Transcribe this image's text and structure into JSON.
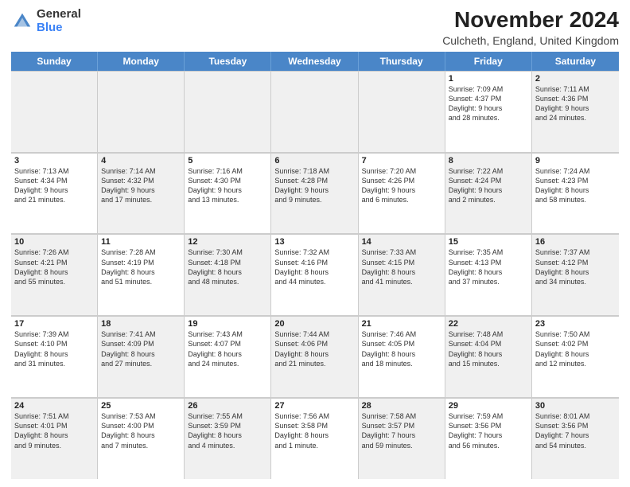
{
  "logo": {
    "general": "General",
    "blue": "Blue"
  },
  "title": {
    "month": "November 2024",
    "location": "Culcheth, England, United Kingdom"
  },
  "header_days": [
    "Sunday",
    "Monday",
    "Tuesday",
    "Wednesday",
    "Thursday",
    "Friday",
    "Saturday"
  ],
  "weeks": [
    [
      {
        "day": "",
        "info": "",
        "shaded": true
      },
      {
        "day": "",
        "info": "",
        "shaded": true
      },
      {
        "day": "",
        "info": "",
        "shaded": true
      },
      {
        "day": "",
        "info": "",
        "shaded": true
      },
      {
        "day": "",
        "info": "",
        "shaded": true
      },
      {
        "day": "1",
        "info": "Sunrise: 7:09 AM\nSunset: 4:37 PM\nDaylight: 9 hours\nand 28 minutes."
      },
      {
        "day": "2",
        "info": "Sunrise: 7:11 AM\nSunset: 4:36 PM\nDaylight: 9 hours\nand 24 minutes.",
        "shaded": true
      }
    ],
    [
      {
        "day": "3",
        "info": "Sunrise: 7:13 AM\nSunset: 4:34 PM\nDaylight: 9 hours\nand 21 minutes."
      },
      {
        "day": "4",
        "info": "Sunrise: 7:14 AM\nSunset: 4:32 PM\nDaylight: 9 hours\nand 17 minutes.",
        "shaded": true
      },
      {
        "day": "5",
        "info": "Sunrise: 7:16 AM\nSunset: 4:30 PM\nDaylight: 9 hours\nand 13 minutes."
      },
      {
        "day": "6",
        "info": "Sunrise: 7:18 AM\nSunset: 4:28 PM\nDaylight: 9 hours\nand 9 minutes.",
        "shaded": true
      },
      {
        "day": "7",
        "info": "Sunrise: 7:20 AM\nSunset: 4:26 PM\nDaylight: 9 hours\nand 6 minutes."
      },
      {
        "day": "8",
        "info": "Sunrise: 7:22 AM\nSunset: 4:24 PM\nDaylight: 9 hours\nand 2 minutes.",
        "shaded": true
      },
      {
        "day": "9",
        "info": "Sunrise: 7:24 AM\nSunset: 4:23 PM\nDaylight: 8 hours\nand 58 minutes."
      }
    ],
    [
      {
        "day": "10",
        "info": "Sunrise: 7:26 AM\nSunset: 4:21 PM\nDaylight: 8 hours\nand 55 minutes.",
        "shaded": true
      },
      {
        "day": "11",
        "info": "Sunrise: 7:28 AM\nSunset: 4:19 PM\nDaylight: 8 hours\nand 51 minutes."
      },
      {
        "day": "12",
        "info": "Sunrise: 7:30 AM\nSunset: 4:18 PM\nDaylight: 8 hours\nand 48 minutes.",
        "shaded": true
      },
      {
        "day": "13",
        "info": "Sunrise: 7:32 AM\nSunset: 4:16 PM\nDaylight: 8 hours\nand 44 minutes."
      },
      {
        "day": "14",
        "info": "Sunrise: 7:33 AM\nSunset: 4:15 PM\nDaylight: 8 hours\nand 41 minutes.",
        "shaded": true
      },
      {
        "day": "15",
        "info": "Sunrise: 7:35 AM\nSunset: 4:13 PM\nDaylight: 8 hours\nand 37 minutes."
      },
      {
        "day": "16",
        "info": "Sunrise: 7:37 AM\nSunset: 4:12 PM\nDaylight: 8 hours\nand 34 minutes.",
        "shaded": true
      }
    ],
    [
      {
        "day": "17",
        "info": "Sunrise: 7:39 AM\nSunset: 4:10 PM\nDaylight: 8 hours\nand 31 minutes."
      },
      {
        "day": "18",
        "info": "Sunrise: 7:41 AM\nSunset: 4:09 PM\nDaylight: 8 hours\nand 27 minutes.",
        "shaded": true
      },
      {
        "day": "19",
        "info": "Sunrise: 7:43 AM\nSunset: 4:07 PM\nDaylight: 8 hours\nand 24 minutes."
      },
      {
        "day": "20",
        "info": "Sunrise: 7:44 AM\nSunset: 4:06 PM\nDaylight: 8 hours\nand 21 minutes.",
        "shaded": true
      },
      {
        "day": "21",
        "info": "Sunrise: 7:46 AM\nSunset: 4:05 PM\nDaylight: 8 hours\nand 18 minutes."
      },
      {
        "day": "22",
        "info": "Sunrise: 7:48 AM\nSunset: 4:04 PM\nDaylight: 8 hours\nand 15 minutes.",
        "shaded": true
      },
      {
        "day": "23",
        "info": "Sunrise: 7:50 AM\nSunset: 4:02 PM\nDaylight: 8 hours\nand 12 minutes."
      }
    ],
    [
      {
        "day": "24",
        "info": "Sunrise: 7:51 AM\nSunset: 4:01 PM\nDaylight: 8 hours\nand 9 minutes.",
        "shaded": true
      },
      {
        "day": "25",
        "info": "Sunrise: 7:53 AM\nSunset: 4:00 PM\nDaylight: 8 hours\nand 7 minutes."
      },
      {
        "day": "26",
        "info": "Sunrise: 7:55 AM\nSunset: 3:59 PM\nDaylight: 8 hours\nand 4 minutes.",
        "shaded": true
      },
      {
        "day": "27",
        "info": "Sunrise: 7:56 AM\nSunset: 3:58 PM\nDaylight: 8 hours\nand 1 minute."
      },
      {
        "day": "28",
        "info": "Sunrise: 7:58 AM\nSunset: 3:57 PM\nDaylight: 7 hours\nand 59 minutes.",
        "shaded": true
      },
      {
        "day": "29",
        "info": "Sunrise: 7:59 AM\nSunset: 3:56 PM\nDaylight: 7 hours\nand 56 minutes."
      },
      {
        "day": "30",
        "info": "Sunrise: 8:01 AM\nSunset: 3:56 PM\nDaylight: 7 hours\nand 54 minutes.",
        "shaded": true
      }
    ]
  ]
}
